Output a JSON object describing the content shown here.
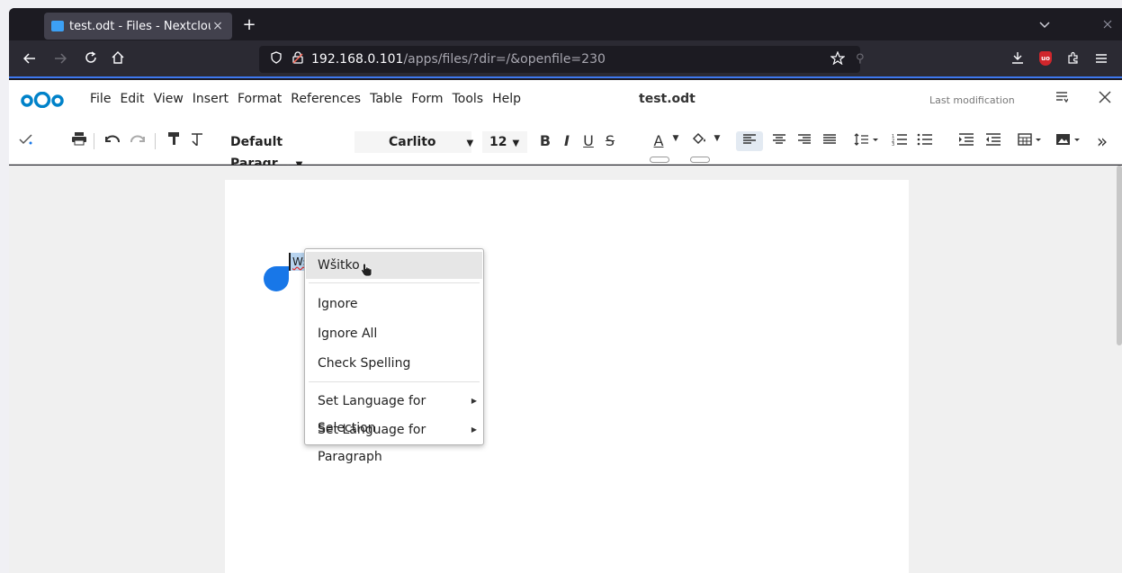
{
  "browser": {
    "tab_title": "test.odt - Files - Nextcloud",
    "tab_close": "×",
    "new_tab": "+",
    "url_host": "192.168.0.101",
    "url_path": "/apps/files/?dir=/&openfile=230",
    "icons": [
      "back-icon",
      "forward-icon",
      "reload-icon",
      "home-icon",
      "shield-icon",
      "lock-icon",
      "star-icon",
      "download-icon",
      "ublock-icon",
      "extensions-icon",
      "menu-icon"
    ],
    "ublock_label": "uo"
  },
  "office": {
    "menus": [
      "File",
      "Edit",
      "View",
      "Insert",
      "Format",
      "References",
      "Table",
      "Form",
      "Tools",
      "Help"
    ],
    "doc_title": "test.odt",
    "last_modification": "Last modification",
    "paragraph_style": "Default Paragr...",
    "font_name": "Carlito",
    "font_size": "12",
    "bold_glyph": "B",
    "italic_glyph": "I",
    "underline_glyph": "U",
    "strike_glyph": "S",
    "font_color_glyph": "A",
    "more_glyph": "»"
  },
  "document": {
    "selected_word": "Wšitk"
  },
  "context_menu": {
    "items": [
      {
        "label": "Wšitko",
        "submenu": false
      },
      {
        "label": "Ignore",
        "submenu": false
      },
      {
        "label": "Ignore All",
        "submenu": false
      },
      {
        "label": "Check Spelling",
        "submenu": false
      },
      {
        "label": "Set Language for Selection",
        "submenu": true
      },
      {
        "label": "Set Language for Paragraph",
        "submenu": true
      }
    ]
  },
  "colors": {
    "accent": "#1877e8",
    "browser_bg": "#1c1b22",
    "selection": "#b8d4ef"
  }
}
